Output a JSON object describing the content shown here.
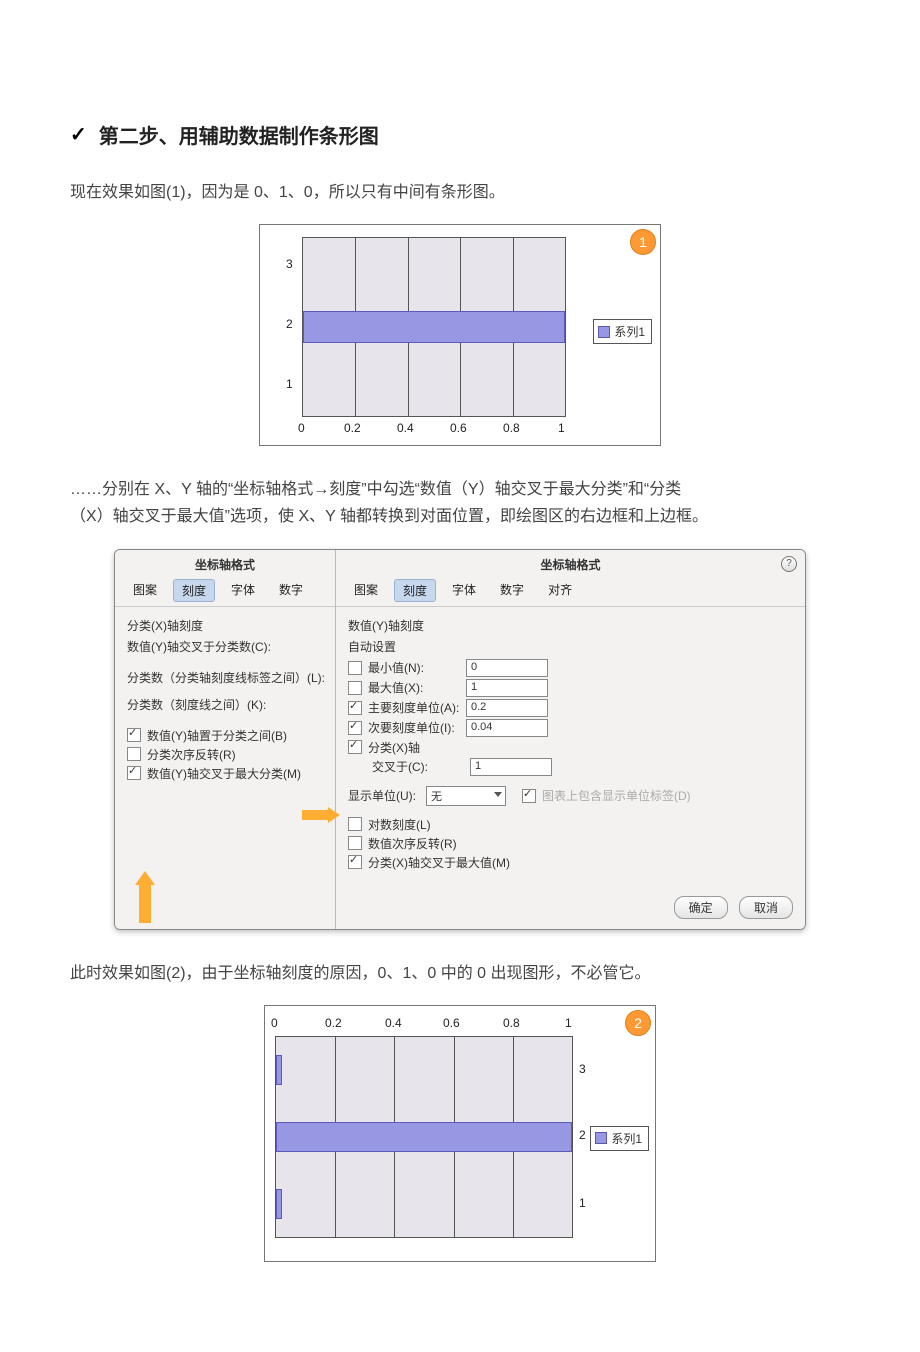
{
  "heading": "第二步、用辅助数据制作条形图",
  "para1": "现在效果如图(1)，因为是 0、1、0，所以只有中间有条形图。",
  "para2a": "……分别在 X、Y 轴的“坐标轴格式→刻度”中勾选“数值（Y）轴交叉于最大分类”和“分类",
  "para2b": "（X）轴交叉于最大值”选项，使 X、Y 轴都转换到对面位置，即绘图区的右边框和上边框。",
  "para3": "此时效果如图(2)，由于坐标轴刻度的原因，0、1、0 中的 0 出现图形，不必管它。",
  "legend": "系列1",
  "badge1": "1",
  "badge2": "2",
  "chart_data": [
    {
      "type": "bar",
      "orientation": "horizontal",
      "categories": [
        "1",
        "2",
        "3"
      ],
      "values": [
        0,
        1,
        0
      ],
      "xlabel": "",
      "ylabel": "",
      "xlim": [
        0,
        1
      ],
      "xticks": [
        "0",
        "0.2",
        "0.4",
        "0.6",
        "0.8",
        "1"
      ],
      "legend": [
        "系列1"
      ],
      "note": "Y axis on left, X axis at bottom"
    },
    {
      "type": "bar",
      "orientation": "horizontal",
      "categories": [
        "1",
        "2",
        "3"
      ],
      "values": [
        0,
        1,
        0
      ],
      "xlabel": "",
      "ylabel": "",
      "xlim": [
        0,
        1
      ],
      "xticks": [
        "0",
        "0.2",
        "0.4",
        "0.6",
        "0.8",
        "1"
      ],
      "legend": [
        "系列1"
      ],
      "note": "Axes swapped: Y categories on right, X ticks at top; 0-value bars visible as thin slivers at left edge"
    }
  ],
  "dialog_left": {
    "title": "坐标轴格式",
    "tabs": [
      "图案",
      "刻度",
      "字体",
      "数字"
    ],
    "active_tab": "刻度",
    "section": "分类(X)轴刻度",
    "line1": "数值(Y)轴交叉于分类数(C):",
    "line2": "分类数（分类轴刻度线标签之间）(L):",
    "line3": "分类数（刻度线之间）(K):",
    "cb1": "数值(Y)轴置于分类之间(B)",
    "cb2": "分类次序反转(R)",
    "cb3": "数值(Y)轴交叉于最大分类(M)"
  },
  "dialog_right": {
    "title": "坐标轴格式",
    "tabs": [
      "图案",
      "刻度",
      "字体",
      "数字",
      "对齐"
    ],
    "active_tab": "刻度",
    "section": "数值(Y)轴刻度",
    "auto": "自动设置",
    "r1": "最小值(N):",
    "r1v": "0",
    "r2": "最大值(X):",
    "r2v": "1",
    "r3": "主要刻度单位(A):",
    "r3v": "0.2",
    "r4": "次要刻度单位(I):",
    "r4v": "0.04",
    "r5a": "分类(X)轴",
    "r5b": "交叉于(C):",
    "r5v": "1",
    "unit_lbl": "显示单位(U):",
    "unit_val": "无",
    "unit_cb": "图表上包含显示单位标签(D)",
    "c1": "对数刻度(L)",
    "c2": "数值次序反转(R)",
    "c3": "分类(X)轴交叉于最大值(M)",
    "ok": "确定",
    "cancel": "取消"
  }
}
